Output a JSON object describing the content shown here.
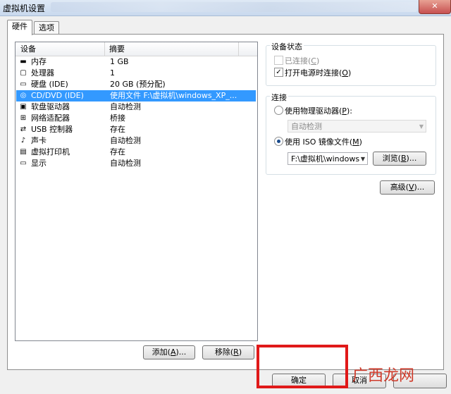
{
  "window": {
    "title": "虚拟机设置",
    "close": "✕"
  },
  "tabs": [
    "硬件",
    "选项"
  ],
  "list": {
    "col_device": "设备",
    "col_summary": "摘要",
    "rows": [
      {
        "name": "内存",
        "summary": "1 GB",
        "icon": "memory-icon",
        "glyph": "▬"
      },
      {
        "name": "处理器",
        "summary": "1",
        "icon": "processor-icon",
        "glyph": "▢"
      },
      {
        "name": "硬盘 (IDE)",
        "summary": "20 GB (预分配)",
        "icon": "hard-disk-icon",
        "glyph": "▭"
      },
      {
        "name": "CD/DVD (IDE)",
        "summary": "使用文件 F:\\虚拟机\\windows_XP_...",
        "icon": "cd-dvd-icon",
        "glyph": "◎"
      },
      {
        "name": "软盘驱动器",
        "summary": "自动检测",
        "icon": "floppy-icon",
        "glyph": "▣"
      },
      {
        "name": "网络适配器",
        "summary": "桥接",
        "icon": "network-adapter-icon",
        "glyph": "⊞"
      },
      {
        "name": "USB 控制器",
        "summary": "存在",
        "icon": "usb-icon",
        "glyph": "⇄"
      },
      {
        "name": "声卡",
        "summary": "自动检测",
        "icon": "sound-card-icon",
        "glyph": "♪"
      },
      {
        "name": "虚拟打印机",
        "summary": "存在",
        "icon": "printer-icon",
        "glyph": "▤"
      },
      {
        "name": "显示",
        "summary": "自动检测",
        "icon": "display-icon",
        "glyph": "▭"
      }
    ],
    "selected_index": 3
  },
  "list_buttons": {
    "add": "添加(",
    "add_key": "A",
    "add_tail": ")...",
    "remove": "移除(",
    "remove_key": "R",
    "remove_tail": ")"
  },
  "device_status": {
    "label": "设备状态",
    "connected": "已连接(",
    "connected_key": "C",
    "connected_tail": ")",
    "connect_power_on": "打开电源时连接(",
    "connect_power_on_key": "O",
    "connect_power_on_tail": ")"
  },
  "connection": {
    "label": "连接",
    "physical": "使用物理驱动器(",
    "physical_key": "P",
    "physical_tail": "):",
    "physical_value": "自动检测",
    "iso": "使用 ISO 镜像文件(",
    "iso_key": "M",
    "iso_tail": ")",
    "iso_value": "F:\\虚拟机\\windows",
    "browse": "浏览(",
    "browse_key": "B",
    "browse_tail": ")..."
  },
  "advanced": {
    "label": "高级(",
    "key": "V",
    "tail": ")..."
  },
  "footer": {
    "ok": "确定",
    "cancel": "取消"
  },
  "watermark": "广西龙网",
  "colors": {
    "selection": "#3399ff",
    "highlight_box": "#e01919"
  }
}
